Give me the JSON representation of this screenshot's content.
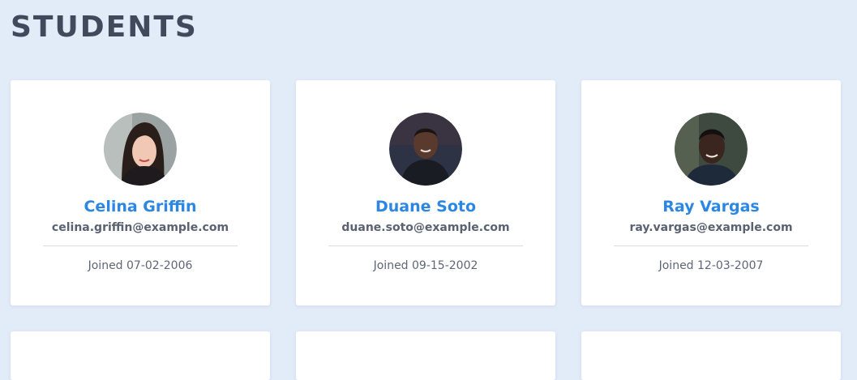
{
  "header": {
    "title": "STUDENTS"
  },
  "students": [
    {
      "name": "Celina Griffin",
      "email": "celina.griffin@example.com",
      "joined": "Joined 07-02-2006"
    },
    {
      "name": "Duane Soto",
      "email": "duane.soto@example.com",
      "joined": "Joined 09-15-2002"
    },
    {
      "name": "Ray Vargas",
      "email": "ray.vargas@example.com",
      "joined": "Joined 12-03-2007"
    }
  ],
  "colors": {
    "background": "#e2ebf8",
    "title": "#404a5c",
    "name_accent": "#2b87e3",
    "card": "#ffffff"
  }
}
